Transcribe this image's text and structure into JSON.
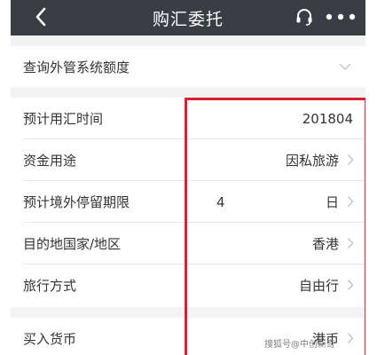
{
  "header": {
    "title": "购汇委托",
    "background_color": "#3a3d43"
  },
  "query": {
    "label": "查询外管系统额度"
  },
  "form": {
    "rows": [
      {
        "label": "预计用汇时间",
        "value": "201804",
        "extra": "",
        "has_chevron": false
      },
      {
        "label": "资金用途",
        "value": "因私旅游",
        "extra": "",
        "has_chevron": true
      },
      {
        "label": "预计境外停留期限",
        "value": "日",
        "extra": "4",
        "has_chevron": true
      },
      {
        "label": "目的地国家/地区",
        "value": "香港",
        "extra": "",
        "has_chevron": true
      },
      {
        "label": "旅行方式",
        "value": "自由行",
        "extra": "",
        "has_chevron": true
      }
    ]
  },
  "currency": {
    "label": "买入货币",
    "value": "港币"
  },
  "watermark": {
    "text": "搜狐号@中创新奇"
  },
  "colors": {
    "highlight": "#d8232f",
    "page_background": "#f3f3f3"
  }
}
